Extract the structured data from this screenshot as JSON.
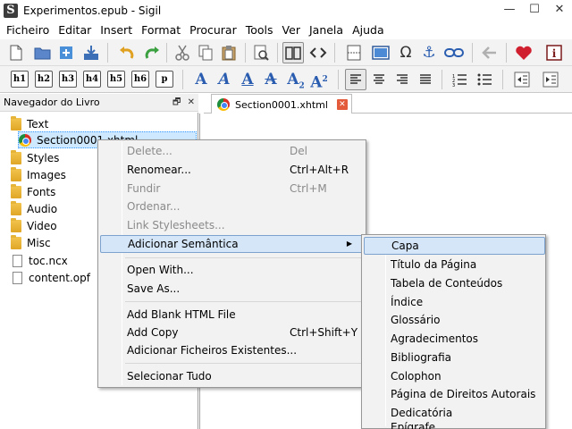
{
  "window": {
    "title": "Experimentos.epub - Sigil",
    "minimize": "—",
    "maximize": "☐",
    "close": "✕"
  },
  "menubar": [
    "Ficheiro",
    "Editar",
    "Insert",
    "Format",
    "Procurar",
    "Tools",
    "Ver",
    "Janela",
    "Ajuda"
  ],
  "toolbar_headings": [
    "h1",
    "h2",
    "h3",
    "h4",
    "h5",
    "h6",
    "p"
  ],
  "toolbar_format": {
    "bold": "A",
    "italic": "A",
    "underline": "A",
    "strike": "A",
    "sub": "A",
    "sub_mark": "2",
    "sup": "A",
    "sup_mark": "2"
  },
  "panel": {
    "title": "Navegador do Livro",
    "float_glyph": "🗗",
    "close_glyph": "✕"
  },
  "tree": [
    {
      "label": "Text",
      "icon": "folder-icon"
    },
    {
      "label": "Section0001.xhtml",
      "icon": "chrome-icon",
      "selected": true
    },
    {
      "label": "Styles",
      "icon": "folder-icon"
    },
    {
      "label": "Images",
      "icon": "folder-icon"
    },
    {
      "label": "Fonts",
      "icon": "folder-icon"
    },
    {
      "label": "Audio",
      "icon": "folder-icon"
    },
    {
      "label": "Video",
      "icon": "folder-icon"
    },
    {
      "label": "Misc",
      "icon": "folder-icon"
    },
    {
      "label": "toc.ncx",
      "icon": "file-icon"
    },
    {
      "label": "content.opf",
      "icon": "file-icon"
    }
  ],
  "tab": {
    "label": "Section0001.xhtml",
    "close_glyph": "✕"
  },
  "context_menu": [
    {
      "label": "Delete...",
      "shortcut": "Del",
      "disabled": true
    },
    {
      "label": "Renomear...",
      "shortcut": "Ctrl+Alt+R",
      "disabled": false
    },
    {
      "label": "Fundir",
      "shortcut": "Ctrl+M",
      "disabled": true
    },
    {
      "label": "Ordenar...",
      "shortcut": "",
      "disabled": true
    },
    {
      "label": "Link Stylesheets...",
      "shortcut": "",
      "disabled": true
    },
    {
      "label": "Adicionar Semântica",
      "shortcut": "",
      "disabled": false,
      "submenu": true
    },
    {
      "label": "Open With...",
      "shortcut": "",
      "disabled": false
    },
    {
      "label": "Save As...",
      "shortcut": "",
      "disabled": false
    },
    {
      "label": "Add Blank HTML File",
      "shortcut": "",
      "disabled": false
    },
    {
      "label": "Add Copy",
      "shortcut": "Ctrl+Shift+Y",
      "disabled": false
    },
    {
      "label": "Adicionar Ficheiros Existentes...",
      "shortcut": "",
      "disabled": false
    },
    {
      "label": "Selecionar Tudo",
      "shortcut": "",
      "disabled": false
    }
  ],
  "submenu_arrow": "▶",
  "semantics_submenu": [
    "Capa",
    "Título da Página",
    "Tabela de Conteúdos",
    "Índice",
    "Glossário",
    "Agradecimentos",
    "Bibliografia",
    "Colophon",
    "Página de Direitos Autorais",
    "Dedicatória",
    "Epígrafe"
  ],
  "colors": {
    "highlight": "#d5e6f8",
    "highlight_border": "#7da2ce",
    "accent_blue": "#2a5db0",
    "heart_red": "#d01f2f"
  }
}
